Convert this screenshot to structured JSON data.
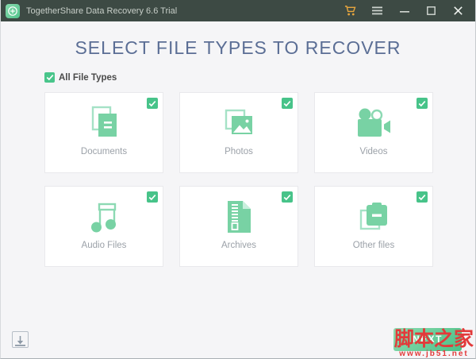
{
  "titlebar": {
    "title": "TogetherShare Data Recovery 6.6 Trial",
    "icons": [
      "app-logo-plus",
      "shopping-cart",
      "hamburger-menu",
      "minimize",
      "maximize",
      "close"
    ]
  },
  "colors": {
    "titlebar_bg": "#3d4a44",
    "accent_green": "#49c58b",
    "icon_green_fill": "#78d2a4",
    "icon_green_outline": "#a5e2c6",
    "heading_blue": "#5b6e95",
    "cart_orange": "#e7a63e",
    "watermark_red": "#e23a3a"
  },
  "main": {
    "heading": "SELECT FILE TYPES TO RECOVER",
    "select_all": {
      "label": "All File Types",
      "checked": true
    },
    "cards": [
      {
        "label": "Documents",
        "icon": "documents-icon",
        "checked": true
      },
      {
        "label": "Photos",
        "icon": "photos-icon",
        "checked": true
      },
      {
        "label": "Videos",
        "icon": "videos-icon",
        "checked": true
      },
      {
        "label": "Audio Files",
        "icon": "audio-icon",
        "checked": true
      },
      {
        "label": "Archives",
        "icon": "archives-icon",
        "checked": true
      },
      {
        "label": "Other files",
        "icon": "other-files-icon",
        "checked": true
      }
    ]
  },
  "footer": {
    "download_icon": "download-tray",
    "next_label": "NEXT"
  },
  "watermark": {
    "text": "脚本之家",
    "url": "www.jb51.net"
  }
}
